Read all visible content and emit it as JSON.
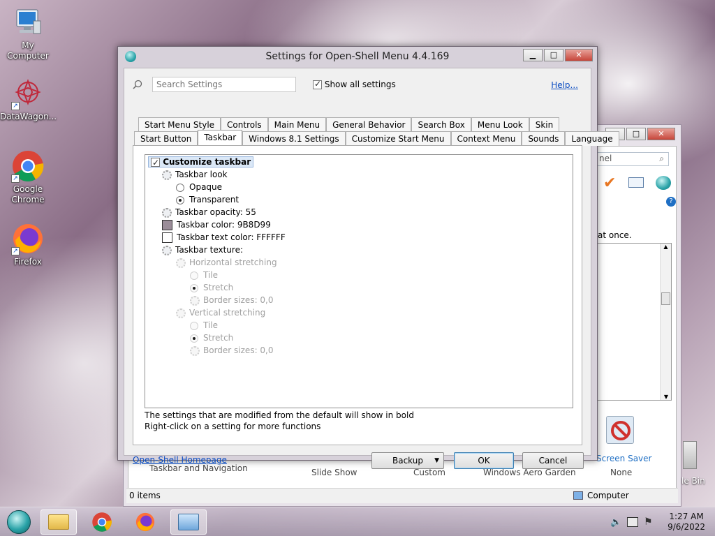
{
  "desktop": {
    "icons": [
      {
        "label": "My Computer"
      },
      {
        "label": "DataWagon..."
      },
      {
        "label": "Google Chrome"
      },
      {
        "label": "Firefox"
      }
    ]
  },
  "background_window": {
    "search_fragment": "nel",
    "text_fragment": "at once.",
    "items": [
      "Taskbar and Navigation",
      "Slide Show",
      "Custom",
      "Windows Aero Garden",
      "None"
    ],
    "screen_saver_label": "Screen Saver",
    "status_items": "0 items",
    "status_location": "Computer",
    "recycle_fragment": "le Bin"
  },
  "dialog": {
    "title": "Settings for Open-Shell Menu 4.4.169",
    "search_placeholder": "Search Settings",
    "show_all_label": "Show all settings",
    "show_all_checked": true,
    "help_label": "Help...",
    "tabs_row1": [
      "Start Menu Style",
      "Controls",
      "Main Menu",
      "General Behavior",
      "Search Box",
      "Menu Look",
      "Skin"
    ],
    "tabs_row2": [
      "Start Button",
      "Taskbar",
      "Windows 8.1 Settings",
      "Customize Start Menu",
      "Context Menu",
      "Sounds",
      "Language"
    ],
    "active_tab": "Taskbar",
    "tree": {
      "customize_taskbar": "Customize taskbar",
      "taskbar_look": "Taskbar look",
      "opaque": "Opaque",
      "transparent": "Transparent",
      "taskbar_opacity": "Taskbar opacity: 55",
      "taskbar_color": "Taskbar color: 9B8D99",
      "taskbar_color_hex": "#9B8D99",
      "taskbar_text_color": "Taskbar text color: FFFFFF",
      "taskbar_text_color_hex": "#FFFFFF",
      "taskbar_texture": "Taskbar texture:",
      "horizontal_stretching": "Horizontal stretching",
      "h_tile": "Tile",
      "h_stretch": "Stretch",
      "h_border_sizes": "Border sizes: 0,0",
      "vertical_stretching": "Vertical stretching",
      "v_tile": "Tile",
      "v_stretch": "Stretch",
      "v_border_sizes": "Border sizes: 0,0"
    },
    "info_line1": "The settings that are modified from the default will show in bold",
    "info_line2": "Right-click on a setting for more functions",
    "homepage_link": "Open-Shell Homepage",
    "backup_label": "Backup",
    "ok_label": "OK",
    "cancel_label": "Cancel"
  },
  "taskbar": {
    "time": "1:27 AM",
    "date": "9/6/2022"
  }
}
